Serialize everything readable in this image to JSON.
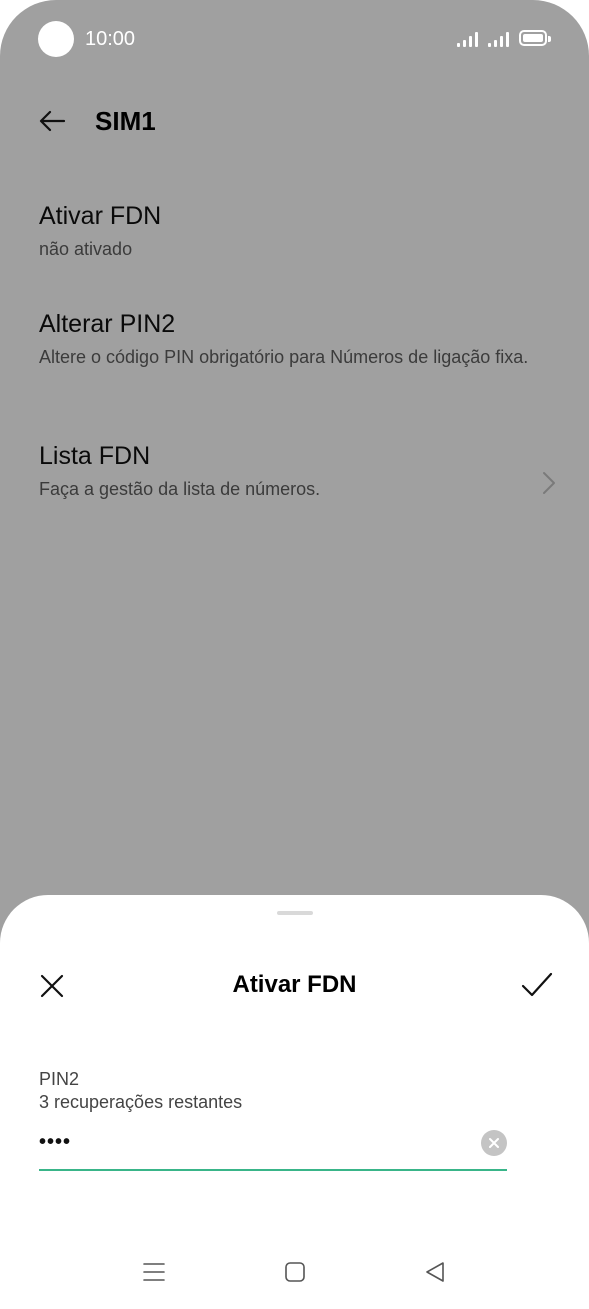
{
  "status_bar": {
    "time": "10:00",
    "icons": [
      "signal-icon",
      "signal-icon",
      "battery-icon"
    ]
  },
  "header": {
    "back_icon": "arrow-left-icon",
    "title": "SIM1"
  },
  "settings": [
    {
      "title": "Ativar FDN",
      "subtitle": "não ativado"
    },
    {
      "title": "Alterar PIN2",
      "subtitle": "Altere o código PIN obrigatório para Números de ligação fixa."
    },
    {
      "title": "Lista FDN",
      "subtitle": "Faça a gestão da lista de números.",
      "icon": "chevron-right-icon"
    }
  ],
  "dialog": {
    "title": "Ativar FDN",
    "close_icon": "close-icon",
    "confirm_icon": "checkmark-icon",
    "pin_label": "PIN2",
    "pin_hint": "3 recuperações restantes",
    "pin_value": "••••",
    "clear_icon": "clear-icon",
    "accent_color": "#39b589"
  },
  "nav_bar": {
    "icons": [
      "menu-icon",
      "home-icon",
      "back-triangle-icon"
    ]
  },
  "colors": {
    "overlay": "#a0a0a0",
    "sheet": "#ffffff"
  }
}
